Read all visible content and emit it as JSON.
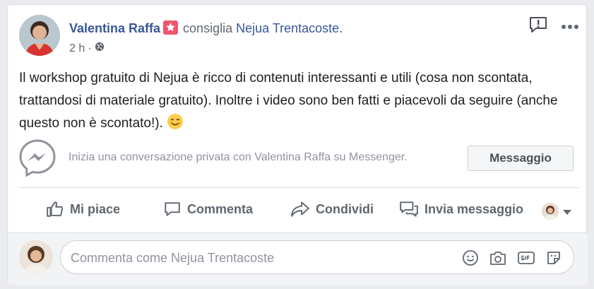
{
  "post": {
    "author": "Valentina Raffa",
    "verb": "consiglia",
    "page": "Nejua Trentacoste.",
    "time": "2 h",
    "separator": "·",
    "text": "Il workshop gratuito di Nejua è ricco di contenuti interessanti e utili (cosa non scontata, trattandosi di materiale gratuito). Inoltre i video sono ben fatti e piacevoli da seguire (anche questo non è scontato!)."
  },
  "messenger": {
    "prompt": "Inizia una conversazione privata con Valentina Raffa su Messenger.",
    "button": "Messaggio"
  },
  "actions": {
    "like": "Mi piace",
    "comment": "Commenta",
    "share": "Condividi",
    "send": "Invia messaggio"
  },
  "comment_box": {
    "placeholder": "Commenta come Nejua Trentacoste"
  },
  "colors": {
    "link": "#385898",
    "badge": "#f0556b",
    "muted": "#606770"
  }
}
